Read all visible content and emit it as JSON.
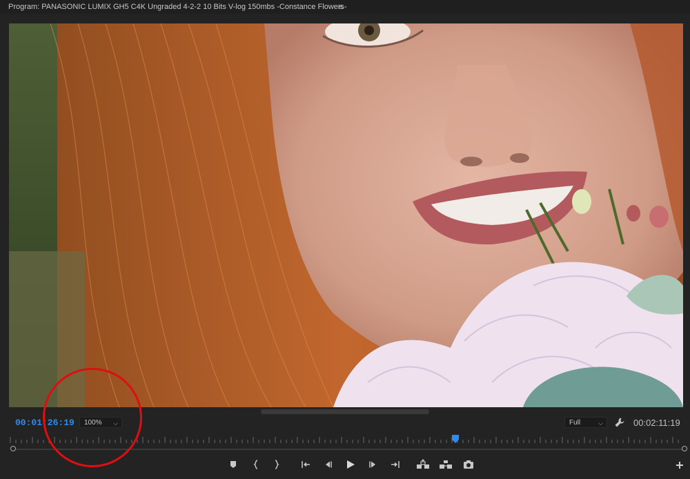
{
  "panel": {
    "title": "Program: PANASONIC LUMIX GH5 C4K Ungraded 4-2-2 10 Bits V-log 150mbs -Constance Flowers-",
    "menu_icon": "hamburger-menu-icon"
  },
  "timecode": {
    "current": "00:01:26:19",
    "duration": "00:02:11:19"
  },
  "zoom": {
    "value": "100%"
  },
  "quality": {
    "value": "Full"
  },
  "transport": {
    "buttons": [
      "add-marker-icon",
      "mark-in-icon",
      "mark-out-icon",
      "go-to-in-icon",
      "step-back-icon",
      "play-icon",
      "step-forward-icon",
      "go-to-out-icon",
      "lift-icon",
      "extract-icon",
      "export-frame-icon"
    ]
  },
  "colors": {
    "current_timecode": "#2d8ceb",
    "playhead": "#2d8ceb",
    "annotation": "#dd0f10",
    "panel_bg": "#232323"
  },
  "playback_position": 0.659
}
